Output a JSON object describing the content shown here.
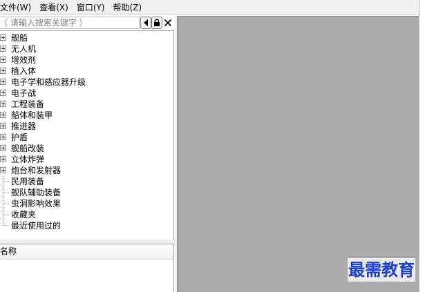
{
  "menu": {
    "items": [
      {
        "label": "文件(W)"
      },
      {
        "label": "查看(X)"
      },
      {
        "label": "窗口(Y)"
      },
      {
        "label": "帮助(Z)"
      }
    ]
  },
  "search": {
    "placeholder": "（ 请输入搜索关键字 ）"
  },
  "toolbar": {
    "back_icon": "triangle-left-icon",
    "lock_icon": "lock-icon",
    "close_icon": "close-icon"
  },
  "tree": {
    "expandable": [
      {
        "label": "舰船"
      },
      {
        "label": "无人机"
      },
      {
        "label": "增效剂"
      },
      {
        "label": "植入体"
      },
      {
        "label": "电子学和感应器升级"
      },
      {
        "label": "电子战"
      },
      {
        "label": "工程装备"
      },
      {
        "label": "船体和装甲"
      },
      {
        "label": "推进器"
      },
      {
        "label": "护盾"
      },
      {
        "label": "舰船改装"
      },
      {
        "label": "立体炸弹"
      },
      {
        "label": "炮台和发射器"
      }
    ],
    "leaves": [
      {
        "label": "民用装备"
      },
      {
        "label": "舰队辅助装备"
      },
      {
        "label": "虫洞影响效果"
      },
      {
        "label": "收藏夹"
      },
      {
        "label": "最近使用过的"
      }
    ]
  },
  "list_panel": {
    "column_header": "名称"
  },
  "colors": {
    "workspace": "#ababab",
    "menubar": "#f0f0f0",
    "watermark": "#1a3fd6"
  },
  "watermark": {
    "text": "最需教育"
  }
}
